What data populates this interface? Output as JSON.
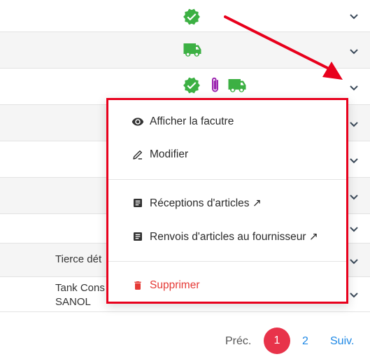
{
  "table": {
    "rows": [
      {
        "icons": [
          "verified-badge-icon"
        ]
      },
      {
        "icons": [
          "truck-icon"
        ]
      },
      {
        "icons": [
          "verified-badge-icon",
          "paperclip-icon",
          "truck-icon"
        ]
      },
      {
        "icons": []
      },
      {
        "icons": []
      },
      {
        "icons": []
      },
      {
        "icons": []
      },
      {
        "text": "Tierce dét"
      },
      {
        "text": "Tank Cons\nSANOL"
      }
    ]
  },
  "menu": {
    "items": [
      {
        "label": "Afficher la facutre",
        "icon": "eye-icon"
      },
      {
        "label": "Modifier",
        "icon": "edit-pen-icon"
      },
      {
        "label": "Réceptions d'articles ↗",
        "icon": "document-icon"
      },
      {
        "label": "Renvois d'articles au fournisseur ↗",
        "icon": "document-icon"
      },
      {
        "label": "Supprimer",
        "icon": "trash-icon"
      }
    ]
  },
  "pagination": {
    "prev": "Préc.",
    "current": "1",
    "page2": "2",
    "next": "Suiv."
  },
  "colors": {
    "green": "#3cb043",
    "purple": "#9c27b0",
    "red": "#e8001c",
    "pager_active": "#e8334a",
    "link_blue": "#1e88e5"
  }
}
